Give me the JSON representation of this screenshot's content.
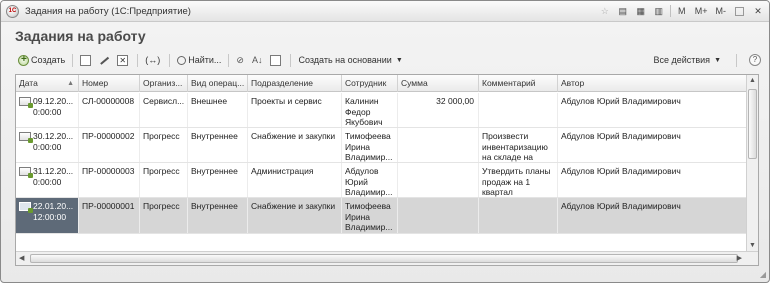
{
  "window": {
    "title": "Задания на работу  (1С:Предприятие)",
    "app_icon_text": "1С",
    "controls": [
      "M",
      "M+",
      "M-"
    ]
  },
  "page_title": "Задания на работу",
  "toolbar": {
    "create_label": "Создать",
    "find_label": "Найти...",
    "create_based_label": "Создать на основании",
    "all_actions_label": "Все действия",
    "help_label": "?"
  },
  "table": {
    "columns": [
      "Дата",
      "Номер",
      "Организ...",
      "Вид операц...",
      "Подразделение",
      "Сотрудник",
      "Сумма",
      "Комментарий",
      "Автор"
    ],
    "rows": [
      {
        "date": "09.12.20... 0:00:00",
        "number": "СЛ-00000008",
        "org": "Сервисл...",
        "op_type": "Внешнее",
        "department": "Проекты и сервис",
        "employee": "Калинин Федор Якубович",
        "sum": "32 000,00",
        "comment": "",
        "author": "Абдулов Юрий Владимирович"
      },
      {
        "date": "30.12.20... 0:00:00",
        "number": "ПР-00000002",
        "org": "Прогресс",
        "op_type": "Внутреннее",
        "department": "Снабжение и закупки",
        "employee": "Тимофеева Ирина Владимир...",
        "sum": "",
        "comment": "Произвести инвентаризацию на складе на",
        "author": "Абдулов Юрий Владимирович"
      },
      {
        "date": "31.12.20... 0:00:00",
        "number": "ПР-00000003",
        "org": "Прогресс",
        "op_type": "Внутреннее",
        "department": "Администрация",
        "employee": "Абдулов Юрий Владимир...",
        "sum": "",
        "comment": "Утвердить планы продаж на 1 квартал",
        "author": "Абдулов Юрий Владимирович"
      },
      {
        "date": "22.01.20... 12:00:00",
        "number": "ПР-00000001",
        "org": "Прогресс",
        "op_type": "Внутреннее",
        "department": "Снабжение и закупки",
        "employee": "Тимофеева Ирина Владимир...",
        "sum": "",
        "comment": "",
        "author": "Абдулов Юрий Владимирович"
      }
    ]
  }
}
